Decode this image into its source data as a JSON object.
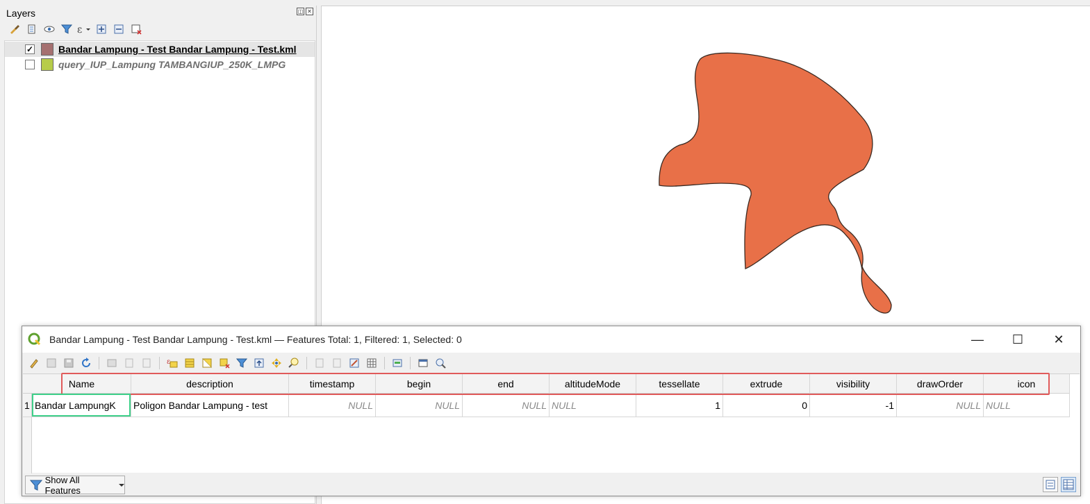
{
  "layers_panel": {
    "title": "Layers",
    "dock_buttons": [
      "float-icon",
      "close-icon"
    ],
    "toolbar_icons": [
      "style-brush-icon",
      "add-group-icon",
      "visibility-eye-icon",
      "filter-legend-icon",
      "expression-filter-icon",
      "expand-all-icon",
      "collapse-all-icon",
      "remove-layer-icon"
    ],
    "layers": [
      {
        "label": "Bandar Lampung - Test Bandar Lampung - Test.kml",
        "checked": true,
        "color": "#a57070"
      },
      {
        "label": "query_IUP_Lampung TAMBANGIUP_250K_LMPG",
        "checked": false,
        "color": "#b7cc4a"
      }
    ]
  },
  "map": {
    "polygon_fill": "#e87048",
    "polygon_stroke": "#3a2a22"
  },
  "attribute_table": {
    "title": "Bandar Lampung - Test Bandar Lampung - Test.kml — Features Total: 1, Filtered: 1, Selected: 0",
    "window_controls": {
      "minimize": "—",
      "maximize": "☐",
      "close": "✕"
    },
    "columns": [
      "Name",
      "description",
      "timestamp",
      "begin",
      "end",
      "altitudeMode",
      "tessellate",
      "extrude",
      "visibility",
      "drawOrder",
      "icon"
    ],
    "rows": [
      {
        "row_number": "1",
        "cells": [
          "Bandar LampungK",
          "Poligon Bandar Lampung - test",
          "NULL",
          "NULL",
          "NULL",
          "NULL",
          "1",
          "0",
          "-1",
          "NULL",
          "NULL"
        ]
      }
    ],
    "footer": {
      "show_features_label": "Show All Features"
    }
  }
}
